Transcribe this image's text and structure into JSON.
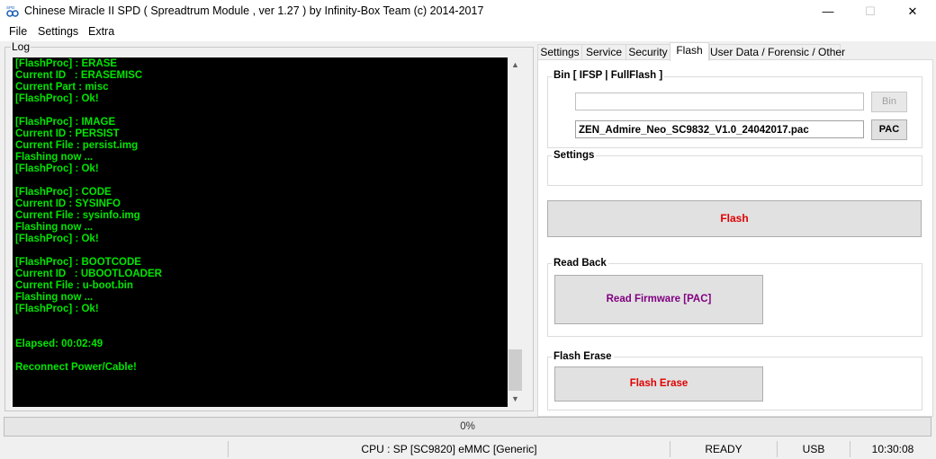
{
  "window": {
    "title": "Chinese Miracle II SPD ( Spreadtrum Module , ver 1.27 ) by Infinity-Box Team (c) 2014-2017",
    "minimize_glyph": "—",
    "maximize_glyph": "☐",
    "close_glyph": "✕"
  },
  "menu": {
    "items": [
      "File",
      "Settings",
      "Extra"
    ]
  },
  "log": {
    "caption": "Log",
    "text": "[FlashProc] : ERASE\nCurrent ID   : ERASEMISC\nCurrent Part : misc\n[FlashProc] : Ok!\n\n[FlashProc] : IMAGE\nCurrent ID : PERSIST\nCurrent File : persist.img\nFlashing now ...\n[FlashProc] : Ok!\n\n[FlashProc] : CODE\nCurrent ID : SYSINFO\nCurrent File : sysinfo.img\nFlashing now ...\n[FlashProc] : Ok!\n\n[FlashProc] : BOOTCODE\nCurrent ID   : UBOOTLOADER\nCurrent File : u-boot.bin\nFlashing now ...\n[FlashProc] : Ok!\n\n\nElapsed: 00:02:49\n\nReconnect Power/Cable!",
    "scroll_up_glyph": "▲",
    "scroll_down_glyph": "▼"
  },
  "tabs": [
    "Settings",
    "Service",
    "Security",
    "Flash",
    "User Data / Forensic / Other"
  ],
  "active_tab": "Flash",
  "flash": {
    "bin_group": {
      "caption": "Bin  [ IFSP | FullFlash ]",
      "bin_path": "",
      "bin_button": "Bin",
      "pac_path": "ZEN_Admire_Neo_SC9832_V1.0_24042017.pac",
      "pac_button": "PAC"
    },
    "settings_caption": "Settings",
    "flash_button": "Flash",
    "read_back": {
      "caption": "Read Back",
      "read_firmware_button": "Read Firmware [PAC]"
    },
    "flash_erase": {
      "caption": "Flash Erase",
      "flash_erase_button": "Flash Erase"
    }
  },
  "progress": {
    "text": "0%",
    "value": 0
  },
  "status": {
    "cpu": "CPU : SP [SC9820] eMMC [Generic]",
    "state": "READY",
    "connection": "USB",
    "time": "10:30:08"
  },
  "colors": {
    "log_text": "#00e600",
    "flash_button_text": "#e00000",
    "read_firmware_text": "#800080",
    "flash_erase_text": "#e00000",
    "app_icon": "#1a5fb4"
  }
}
